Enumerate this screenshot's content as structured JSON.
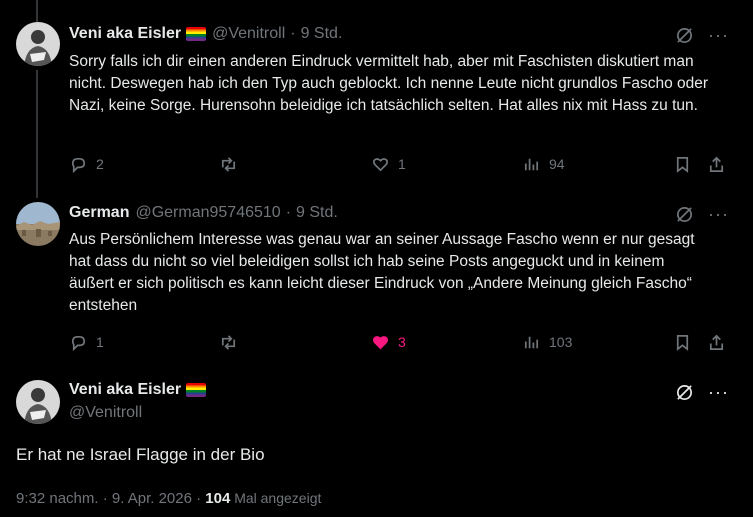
{
  "tweets": [
    {
      "name": "Veni aka Eisler",
      "handle": "@Venitroll",
      "time": "9 Std.",
      "text": "Sorry falls ich dir einen anderen Eindruck vermittelt hab, aber mit Faschisten diskutiert man nicht. Deswegen hab ich den Typ auch geblockt. Ich nenne Leute nicht grundlos Fascho oder Nazi, keine Sorge. Hurensohn beleidige ich tatsächlich selten. Hat alles nix mit Hass zu tun.",
      "replies": "2",
      "retweets": "",
      "likes": "1",
      "views": "94"
    },
    {
      "name": "German",
      "handle": "@German95746510",
      "time": "9 Std.",
      "text": "Aus Persönlichem Interesse was genau war an seiner Aussage Fascho wenn er nur gesagt hat dass du nicht so viel beleidigen sollst ich hab seine Posts angeguckt und in keinem äußert er sich politisch es kann leicht dieser Eindruck von „Andere Meinung gleich Fascho“ entstehen",
      "replies": "1",
      "retweets": "",
      "likes": "3",
      "views": "103"
    }
  ],
  "main": {
    "name": "Veni aka Eisler",
    "handle": "@Venitroll",
    "text": "Er hat ne Israel Flagge in der Bio",
    "timestamp": "9:32 nachm. · 9. Apr. 2026 · ",
    "views_count": "104",
    "views_label": " Mal angezeigt"
  },
  "colors": {
    "like_active": "#f91880",
    "muted": "#71767b",
    "text": "#e7e9ea"
  }
}
